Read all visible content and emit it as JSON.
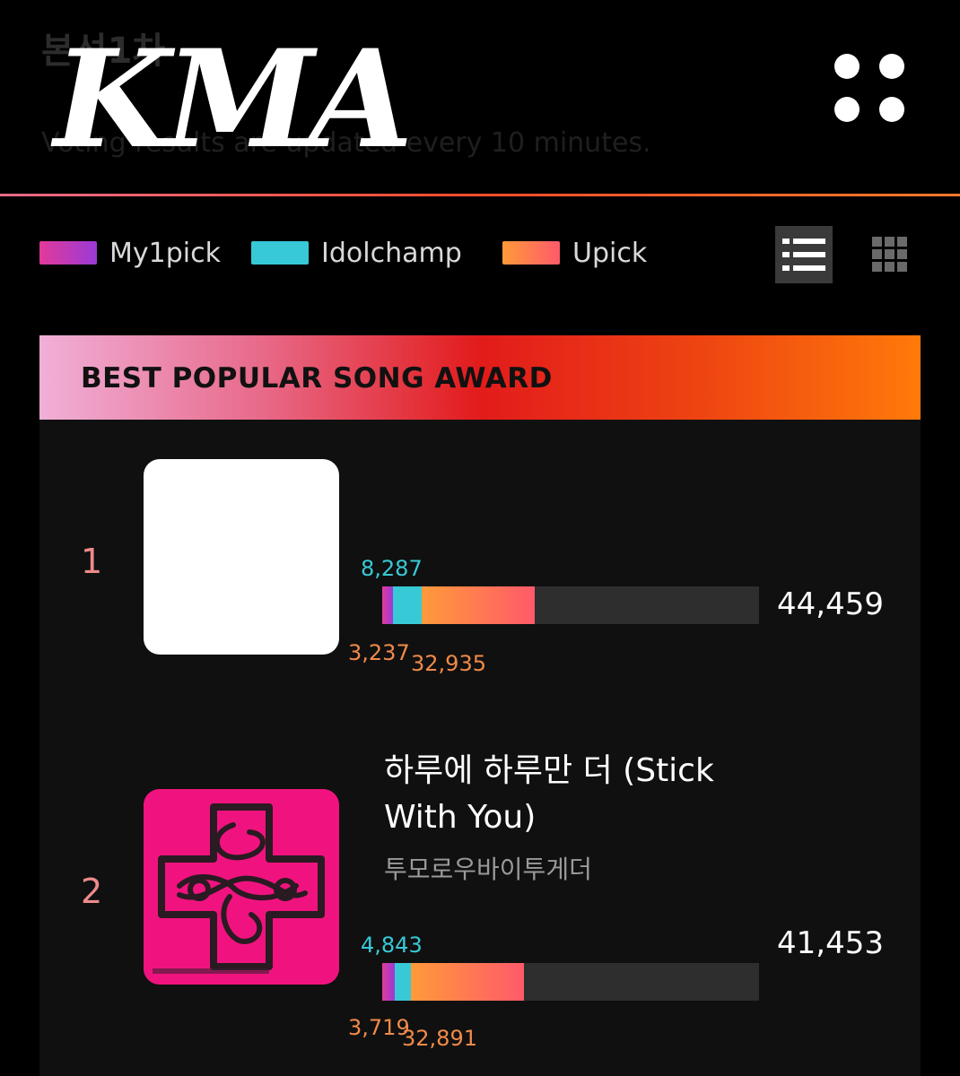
{
  "header": {
    "ghost_title": "본선1차",
    "logo": "KMA",
    "subtitle": "Voting results are updated every 10 minutes.",
    "menu_icon": "four-dots-menu-icon"
  },
  "legend": [
    {
      "label": "My1pick",
      "color_start": "#e23a9a",
      "color_end": "#9a3ad6"
    },
    {
      "label": "Idolchamp",
      "color_start": "#38c9d6",
      "color_end": "#38c9d6"
    },
    {
      "label": "Upick",
      "color_start": "#ff9a3a",
      "color_end": "#ff5a6a"
    }
  ],
  "view_toggle": {
    "list_icon": "list-view-icon",
    "grid_icon": "grid-view-icon",
    "active": "list"
  },
  "award": {
    "title": "BEST POPULAR SONG AWARD",
    "entries": [
      {
        "rank": "1",
        "song_title": "",
        "artist": "",
        "cover": "blank-cover-image",
        "my1pick": 3237,
        "my1pick_label": "3,237",
        "idolchamp": 8287,
        "idolchamp_label": "8,287",
        "upick": 32935,
        "upick_label": "32,935",
        "total_label": "44,459"
      },
      {
        "rank": "2",
        "song_title": "하루에 하루만 더 (Stick With You)",
        "artist": "투모로우바이투게더",
        "cover": "pink-cross-album-cover",
        "my1pick": 3719,
        "my1pick_label": "3,719",
        "idolchamp": 4843,
        "idolchamp_label": "4,843",
        "upick": 32891,
        "upick_label": "32,891",
        "total_label": "41,453"
      }
    ]
  },
  "colors": {
    "accent_pink": "#e86a8a",
    "accent_orange": "#ff7a0a",
    "idolchamp": "#38c9d6",
    "upick_label": "#f08a4a",
    "rank": "#f08a8a"
  }
}
